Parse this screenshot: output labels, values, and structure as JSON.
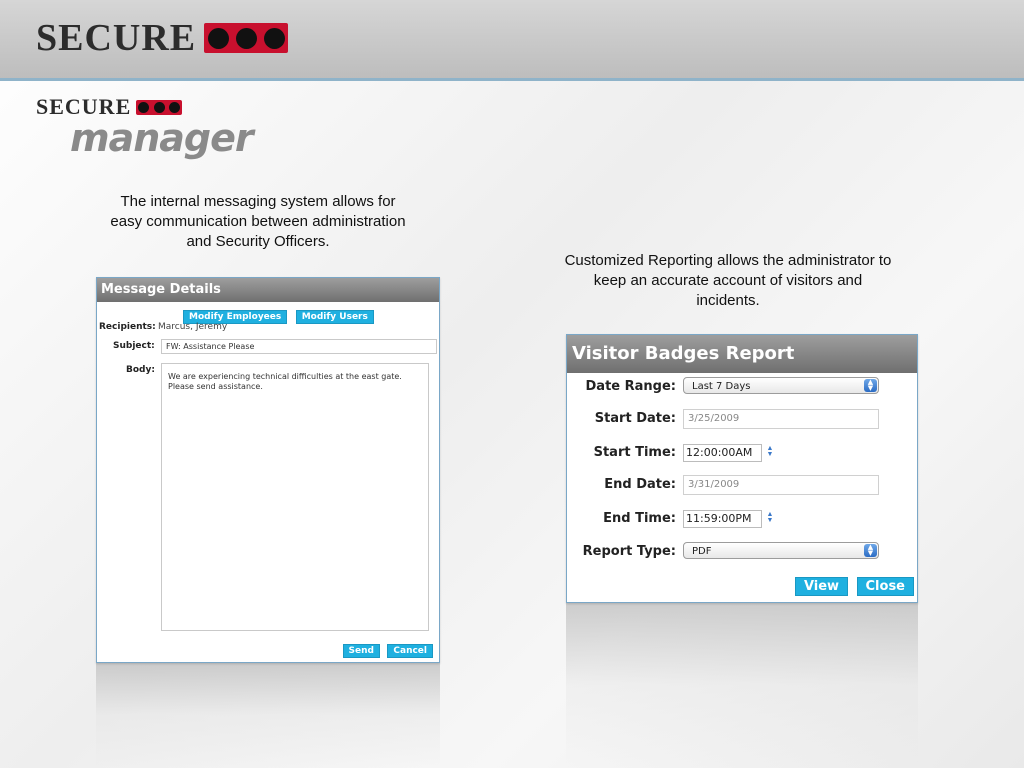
{
  "brand": {
    "word": "SECURE",
    "product": "manager"
  },
  "captions": {
    "left": "The internal messaging system allows for easy communication between administration and Security Officers.",
    "right": "Customized Reporting allows the administrator to keep an accurate account of visitors and incidents."
  },
  "message": {
    "title": "Message Details",
    "modify_employees": "Modify Employees",
    "modify_users": "Modify Users",
    "recipients_label": "Recipients:",
    "recipients_value": "Marcus, Jeremy",
    "subject_label": "Subject:",
    "subject_value": "FW:  Assistance Please",
    "body_label": "Body:",
    "body_value": "We are experiencing technical difficulties at the east gate. Please send assistance.",
    "send": "Send",
    "cancel": "Cancel"
  },
  "report": {
    "title": "Visitor Badges Report",
    "date_range_label": "Date Range:",
    "date_range_value": "Last 7 Days",
    "start_date_label": "Start Date:",
    "start_date_value": "3/25/2009",
    "start_time_label": "Start Time:",
    "start_time_value": "12:00:00AM",
    "end_date_label": "End Date:",
    "end_date_value": "3/31/2009",
    "end_time_label": "End Time:",
    "end_time_value": "11:59:00PM",
    "report_type_label": "Report Type:",
    "report_type_value": "PDF",
    "view": "View",
    "close": "Close"
  },
  "colors": {
    "brand_red": "#c8102e",
    "button_blue": "#1fb0e0",
    "title_gray": "#7d7d7d",
    "panel_border": "#7aa7c7"
  },
  "icons": {
    "select_arrow": "updown-arrows-icon",
    "time_stepper": "stepper-icon"
  }
}
